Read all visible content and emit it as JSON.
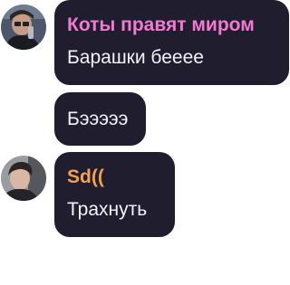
{
  "messages": [
    {
      "sender": "Коты правят миром",
      "sender_color": "#f27ad0",
      "text": "Барашки беееe",
      "avatar": "user-avatar-photo-icon"
    },
    {
      "text": "Бэээээ"
    },
    {
      "sender": "Sd((",
      "sender_color": "#f2a154",
      "text": "Трахнуть",
      "avatar": "user-avatar-photo-icon"
    }
  ],
  "colors": {
    "bubble": "#201d2e",
    "text": "#f4f2f8"
  }
}
